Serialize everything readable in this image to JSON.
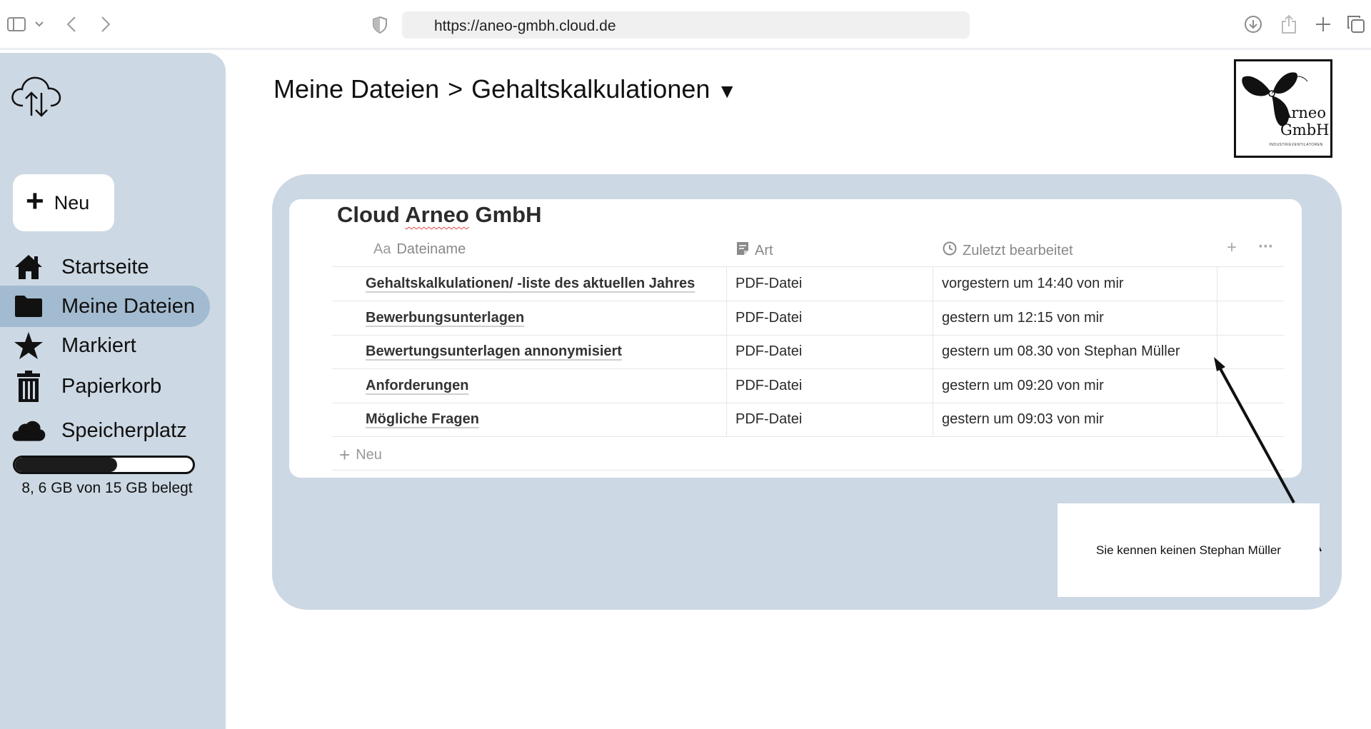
{
  "browser": {
    "url": "https://aneo-gmbh.cloud.de"
  },
  "sidebar": {
    "new_label": "Neu",
    "items": [
      {
        "label": "Startseite",
        "icon": "home-icon",
        "active": false
      },
      {
        "label": "Meine Dateien",
        "icon": "folder-icon",
        "active": true
      },
      {
        "label": "Markiert",
        "icon": "star-icon",
        "active": false
      },
      {
        "label": "Papierkorb",
        "icon": "trash-icon",
        "active": false
      },
      {
        "label": "Speicherplatz",
        "icon": "cloud-icon",
        "active": false
      }
    ],
    "storage": {
      "used_gb": 8.6,
      "total_gb": 15,
      "text": "8, 6 GB von 15 GB belegt"
    }
  },
  "breadcrumb": {
    "root": "Meine Dateien",
    "separator": ">",
    "current": "Gehaltskalkulationen",
    "caret": "▼"
  },
  "brand": {
    "name_line1": "Arneo",
    "name_line2": "GmbH",
    "tagline": "INDUSTRIEVENTILATOREN"
  },
  "table": {
    "title_part1": "Cloud ",
    "title_part2": "Arneo",
    "title_part3": " GmbH",
    "columns": {
      "name": "Dateiname",
      "name_icon": "Aa",
      "type": "Art",
      "modified": "Zuletzt bearbeitet"
    },
    "add_column": "+",
    "more": "···",
    "rows": [
      {
        "name": "Gehaltskalkulationen/ -liste des aktuellen Jahres",
        "type": "PDF-Datei",
        "modified": "vorgestern um 14:40 von mir"
      },
      {
        "name": "Bewerbungsunterlagen",
        "type": "PDF-Datei",
        "modified": "gestern um 12:15 von mir"
      },
      {
        "name": "Bewertungsunterlagen annonymisiert",
        "type": "PDF-Datei",
        "modified": "gestern um 08.30 von Stephan Müller"
      },
      {
        "name": "Anforderungen",
        "type": "PDF-Datei",
        "modified": "gestern um 09:20 von mir"
      },
      {
        "name": "Mögliche Fragen",
        "type": "PDF-Datei",
        "modified": "gestern um 09:03 von mir"
      }
    ],
    "add_row_label": "Neu"
  },
  "annotation": {
    "text": "Sie kennen keinen Stephan Müller"
  },
  "colors": {
    "sidebar_bg": "#ccd8e3",
    "active_item": "#a3bbd0",
    "panel_bg": "#ccd8e3"
  }
}
